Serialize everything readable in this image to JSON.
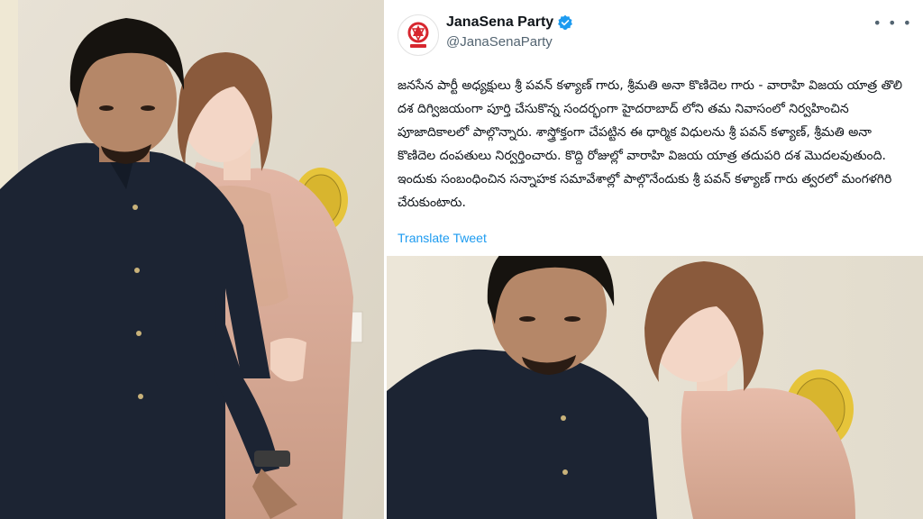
{
  "tweet": {
    "display_name": "JanaSena Party",
    "handle": "@JanaSenaParty",
    "verified": true,
    "text": "జనసేన పార్టీ అధ్యక్షులు శ్రీ పవన్ కళ్యాణ్ గారు, శ్రీమతి అనా కొణిదెల గారు - వారాహి విజయ యాత్ర తొలి దశ దిగ్విజయంగా పూర్తి చేసుకొన్న సందర్భంగా హైదరాబాద్ లోని తమ నివాసంలో నిర్వహించిన పూజాదికాలలో పాల్గొన్నారు. శాస్త్రోక్తంగా చేపట్టిన ఈ ధార్మిక విధులను శ్రీ పవన్ కళ్యాణ్, శ్రీమతి అనా కొణిదెల దంపతులు నిర్వర్తించారు. కొద్ది రోజుల్లో వారాహి విజయ యాత్ర తదుపరి దశ మొదలవుతుంది. ఇందుకు సంబంధించిన సన్నాహక సమావేశాల్లో పాల్గొనేందుకు శ్రీ పవన్ కళ్యాణ్ గారు త్వరలో మంగళగిరి చేరుకుంటారు.",
    "translate_label": "Translate Tweet",
    "more_icon": "more-horizontal-icon",
    "avatar_icon": "janasena-logo",
    "verified_color": "#1d9bf0",
    "link_color": "#1d9bf0",
    "brand_color": "#d7262e"
  },
  "photos": {
    "left": "photo-couple-full",
    "right": "photo-couple-closeup"
  }
}
